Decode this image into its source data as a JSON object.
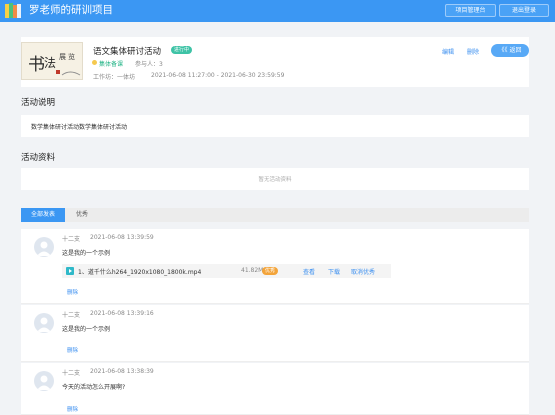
{
  "app": {
    "title": "罗老师的研训项目",
    "project_manage_label": "项目管理台",
    "logout_label": "退出登录"
  },
  "activity": {
    "title": "语文集体研讨活动",
    "status": "进行中",
    "type": "集体备课",
    "participants": "参与人：3",
    "workroom": "工作坊：一体坊",
    "time_range": "2021-06-08 11:27:00 - 2021-06-30 23:59:59",
    "edit_label": "编辑",
    "delete_label": "删除",
    "back_label": "《《 返回",
    "cover_text": "书法展览"
  },
  "sections": {
    "description_title": "活动说明",
    "description_text": "数学集体研讨活动数学集体研讨活动",
    "materials_title": "活动资料",
    "materials_empty": "暂无活动资料"
  },
  "tabs": [
    {
      "label": "全部发表"
    },
    {
      "label": "优秀"
    }
  ],
  "comments": [
    {
      "author": "十二支",
      "time": "2021-06-08 13:39:59",
      "text": "这是我的一个示例",
      "delete_label": "删除",
      "attachment": {
        "name": "1、道千什么h264_1920x1080_1800k.mp4",
        "size": "41.82MB",
        "badge": "优秀",
        "view_label": "查看",
        "download_label": "下载",
        "cancel_label": "取消优秀"
      }
    },
    {
      "author": "十二支",
      "time": "2021-06-08 13:39:16",
      "text": "这是我的一个示例",
      "delete_label": "删除"
    },
    {
      "author": "十二支",
      "time": "2021-06-08 13:38:39",
      "text": "今天的活动怎么开展啊?",
      "delete_label": "删除"
    }
  ],
  "colors": {
    "primary": "#3b97f3",
    "link": "#3b8ff0",
    "status_green": "#3ec3a6",
    "badge_orange": "#f3a43a",
    "page_bg": "#f1f3f6"
  },
  "icons": [
    "books-logo-icon",
    "video-file-icon",
    "user-avatar-icon"
  ]
}
